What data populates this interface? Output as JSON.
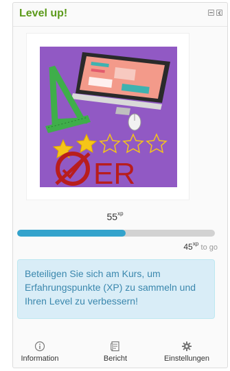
{
  "block": {
    "title": "Level up!"
  },
  "level": {
    "xp": "55",
    "xp_unit": "xp",
    "xp_to_go": "45",
    "xp_to_go_unit": "xp",
    "to_go_label": "to go",
    "progress_percent": 55,
    "badge_text": "ER",
    "stars_filled": 2,
    "stars_total": 5
  },
  "info": {
    "message": "Beteiligen Sie sich am Kurs, um Erfahrungspunkte (XP) zu sammeln und Ihren Level zu verbessern!"
  },
  "actions": [
    {
      "label": "Information",
      "icon": "info-icon"
    },
    {
      "label": "Bericht",
      "icon": "report-icon"
    },
    {
      "label": "Einstellungen",
      "icon": "gear-icon"
    }
  ],
  "colors": {
    "title": "#5b9a1a",
    "progress_fill": "#33a3cc",
    "progress_track": "#d2d2d2",
    "info_bg": "#d9edf7",
    "info_text": "#3a87ad",
    "badge_bg": "#9159c4"
  }
}
